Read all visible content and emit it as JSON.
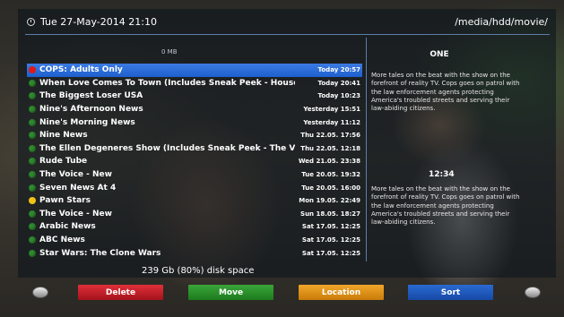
{
  "header": {
    "datetime": "Tue 27-May-2014 21:10",
    "path": "/media/hdd/movie/"
  },
  "list": {
    "top_size": "0 MB",
    "items": [
      {
        "title": "COPS: Adults Only",
        "date": "Today 20:57",
        "dot": "red",
        "selected": true
      },
      {
        "title": "When Love Comes To Town (Includes Sneak Peek - House",
        "date": "Today 20:41",
        "dot": "green"
      },
      {
        "title": "The Biggest Loser USA",
        "date": "Today 10:23",
        "dot": "green"
      },
      {
        "title": "Nine's Afternoon News",
        "date": "Yesterday 15:51",
        "dot": "green"
      },
      {
        "title": "Nine's Morning News",
        "date": "Yesterday 11:12",
        "dot": "green"
      },
      {
        "title": "Nine News",
        "date": "Thu 22.05. 17:56",
        "dot": "green"
      },
      {
        "title": "The Ellen Degeneres Show (Includes Sneak Peek - The Voic",
        "date": "Thu 22.05. 12:18",
        "dot": "green"
      },
      {
        "title": "Rude Tube",
        "date": "Wed 21.05. 23:38",
        "dot": "green"
      },
      {
        "title": "The Voice - New",
        "date": "Tue 20.05. 19:32",
        "dot": "green"
      },
      {
        "title": "Seven News At 4",
        "date": "Tue 20.05. 16:00",
        "dot": "green"
      },
      {
        "title": "Pawn Stars",
        "date": "Mon 19.05. 22:49",
        "dot": "yellow"
      },
      {
        "title": "The Voice - New",
        "date": "Sun 18.05. 18:27",
        "dot": "green"
      },
      {
        "title": "Arabic News",
        "date": "Sat 17.05. 12:25",
        "dot": "green"
      },
      {
        "title": "ABC News",
        "date": "Sat 17.05. 12:25",
        "dot": "green"
      },
      {
        "title": "Star Wars: The Clone Wars",
        "date": "Sat 17.05. 12:25",
        "dot": "green"
      }
    ],
    "disk_space": "239 Gb (80%) disk space"
  },
  "details": {
    "channel": "ONE",
    "description": "More tales on the beat with the show on the forefront of reality TV. Cops goes on patrol with the law enforcement agents protecting America's troubled streets and serving their law-abiding citizens.",
    "time": "12:34",
    "description2": "More tales on the beat with the show on the forefront of reality TV. Cops goes on patrol with the law enforcement agents protecting America's troubled streets and serving their law-abiding citizens."
  },
  "buttons": {
    "red": "Delete",
    "green": "Move",
    "yellow": "Location",
    "blue": "Sort"
  },
  "colors": {
    "selection": "#2a6ad2",
    "divider": "#5b7fa6"
  }
}
